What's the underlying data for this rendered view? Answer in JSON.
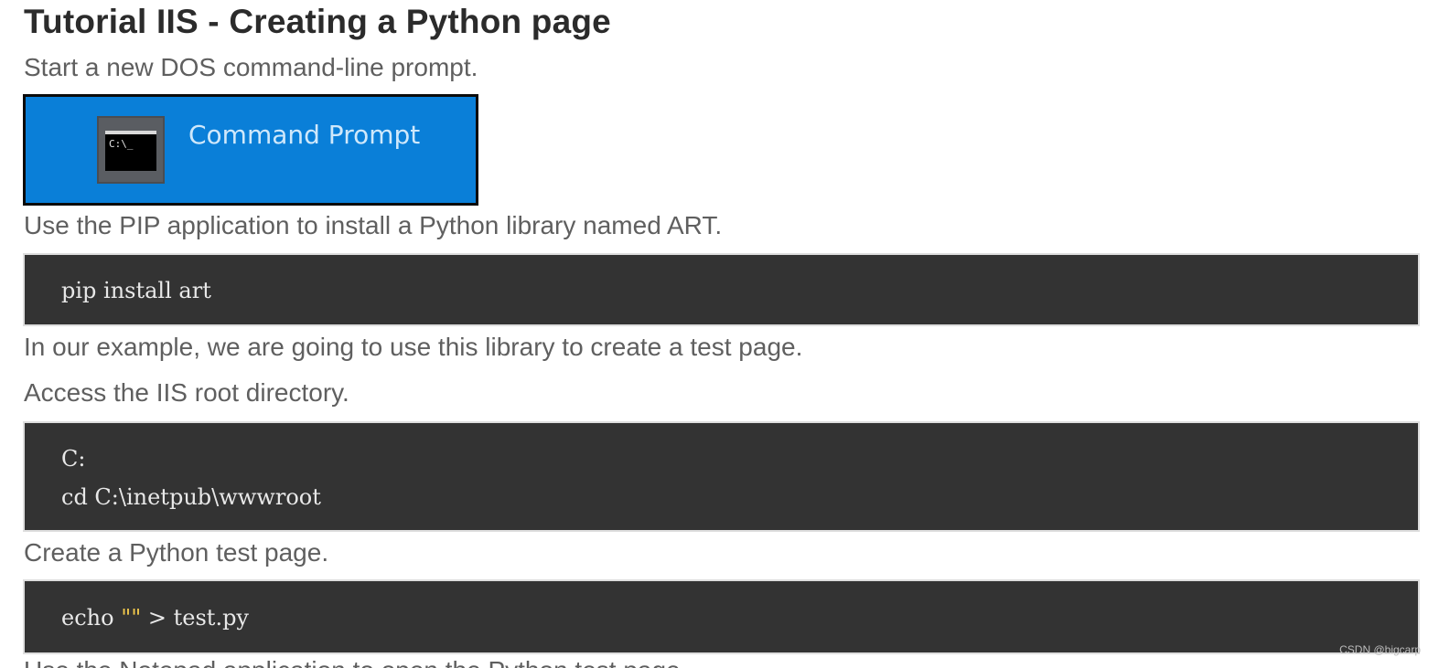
{
  "title": "Tutorial IIS - Creating a Python page",
  "paragraphs": {
    "p1": "Start a new DOS command-line prompt.",
    "p2": "Use the PIP application to install a Python library named ART.",
    "p3": "In our example, we are going to use this library to create a test page.",
    "p4": "Access the IIS root directory.",
    "p5": "Create a Python test page.",
    "p6": "Use the Notepad application to open the Python test page."
  },
  "screenshot": {
    "label": "Command Prompt",
    "icon_text": "C:\\_",
    "background": "#0a7fd8",
    "icon": "command-prompt-icon"
  },
  "code": {
    "block1": {
      "line1": "pip install art"
    },
    "block2": {
      "line1": "C:",
      "line2": "cd C:\\inetpub\\wwwroot"
    },
    "block3": {
      "cmd": "echo ",
      "string": "\"\"",
      "rest": " > test.py"
    }
  },
  "watermark": "CSDN @bigcarp",
  "colors": {
    "code_background": "#333333",
    "code_text": "#e8e8e8",
    "string_highlight": "#f2c94c",
    "body_text": "#5f5f5f"
  }
}
